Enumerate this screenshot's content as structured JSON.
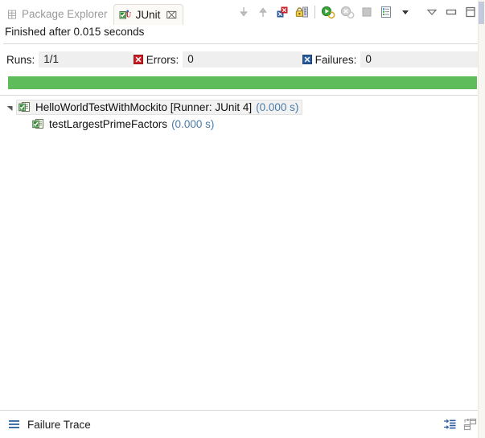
{
  "tabs": [
    {
      "label": "Package Explorer",
      "icon": "package-explorer-icon",
      "active": false,
      "closable": false
    },
    {
      "label": "JUnit",
      "icon": "junit-icon",
      "active": true,
      "closable": true,
      "close_glyph": "⌧"
    }
  ],
  "toolbar": {
    "buttons": [
      {
        "name": "next-failed-test-button",
        "icon": "arrow-down-icon",
        "enabled": false
      },
      {
        "name": "previous-failed-test-button",
        "icon": "arrow-up-icon",
        "enabled": false
      },
      {
        "name": "show-failures-only-button",
        "icon": "show-failures-icon",
        "enabled": true
      },
      {
        "name": "scroll-lock-button",
        "icon": "lock-icon",
        "enabled": true
      },
      {
        "name": "rerun-test-button",
        "icon": "rerun-icon",
        "enabled": true
      },
      {
        "name": "rerun-failed-tests-button",
        "icon": "rerun-failed-icon",
        "enabled": false
      },
      {
        "name": "stop-test-run-button",
        "icon": "stop-icon",
        "enabled": false
      },
      {
        "name": "test-run-history-button",
        "icon": "history-icon",
        "enabled": true
      },
      {
        "name": "history-dropdown-button",
        "icon": "chevron-down-icon",
        "enabled": true
      }
    ],
    "view_menu": {
      "name": "view-menu-button",
      "icon": "view-menu-icon"
    },
    "minimize": {
      "name": "minimize-view-button",
      "icon": "minimize-icon"
    },
    "maximize": {
      "name": "maximize-view-button",
      "icon": "maximize-icon"
    }
  },
  "status": {
    "text": "Finished after 0.015 seconds"
  },
  "counters": {
    "runs": {
      "label": "Runs:",
      "value": "1/1"
    },
    "errors": {
      "label": "Errors:",
      "value": "0",
      "icon": "error-icon",
      "color": "#cc1f26"
    },
    "failures": {
      "label": "Failures:",
      "value": "0",
      "icon": "failure-icon",
      "color": "#2a5d9e"
    }
  },
  "progress": {
    "percent": 100,
    "color": "#5fbc5a",
    "state": "passed"
  },
  "tree": {
    "root": {
      "label": "HelloWorldTestWithMockito [Runner: JUnit 4]",
      "time": "(0.000 s)",
      "expanded": true,
      "icon": "test-class-passed-icon",
      "twisty": "◢",
      "selected": true
    },
    "children": [
      {
        "label": "testLargestPrimeFactors",
        "time": "(0.000 s)",
        "icon": "test-method-passed-icon",
        "selected": false
      }
    ]
  },
  "footer": {
    "title": "Failure Trace",
    "icon": "failure-trace-icon",
    "actions": [
      {
        "name": "copy-trace-button",
        "icon": "compare-trace-icon"
      },
      {
        "name": "filter-stack-trace-button",
        "icon": "filter-stack-icon"
      }
    ]
  },
  "colors": {
    "pass_green": "#5fbc5a",
    "error_red": "#cc1f26",
    "failure_blue": "#2a5d9e",
    "time_blue": "#4a7ba8",
    "field_gray": "#efefef"
  }
}
